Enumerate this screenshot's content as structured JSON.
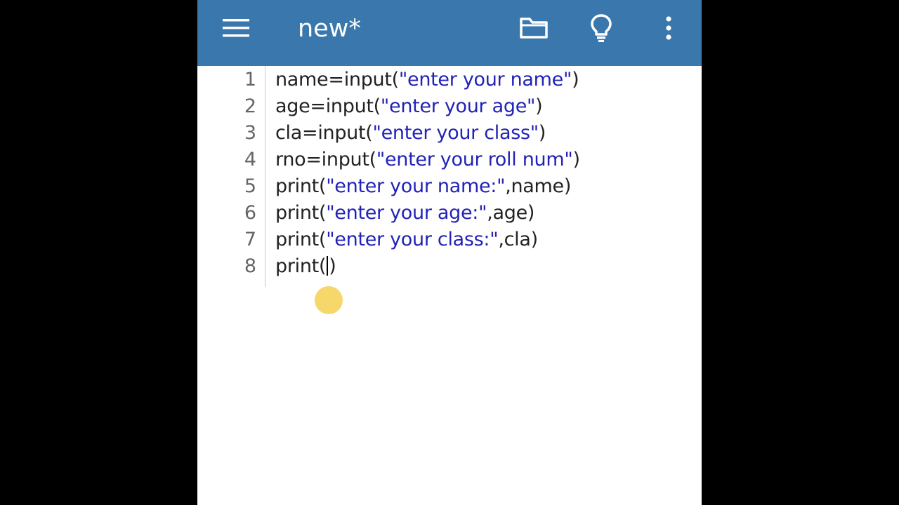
{
  "app": {
    "title": "new*",
    "icons": [
      "menu-icon",
      "folder-icon",
      "lightbulb-icon",
      "more-vert-icon"
    ],
    "colors": {
      "appbar": "#3a77ad",
      "string": "#2222b8",
      "text": "#222222",
      "line_number": "#666666"
    }
  },
  "editor": {
    "lines": [
      {
        "num": "1",
        "pre": "name=input(",
        "str": "\"enter your name\"",
        "post": ")"
      },
      {
        "num": "2",
        "pre": "age=input(",
        "str": "\"enter your age\"",
        "post": ")"
      },
      {
        "num": "3",
        "pre": "cla=input(",
        "str": "\"enter your class\"",
        "post": ")"
      },
      {
        "num": "4",
        "pre": "rno=input(",
        "str": "\"enter your roll num\"",
        "post": ")"
      },
      {
        "num": "5",
        "pre": "print(",
        "str": "\"enter your name:\"",
        "post": ",name)"
      },
      {
        "num": "6",
        "pre": "print(",
        "str": "\"enter your age:\"",
        "post": ",age)"
      },
      {
        "num": "7",
        "pre": "print(",
        "str": "\"enter your class:\"",
        "post": ",cla)"
      },
      {
        "num": "8",
        "pre": "print(",
        "str": "",
        "post": ")"
      }
    ]
  }
}
